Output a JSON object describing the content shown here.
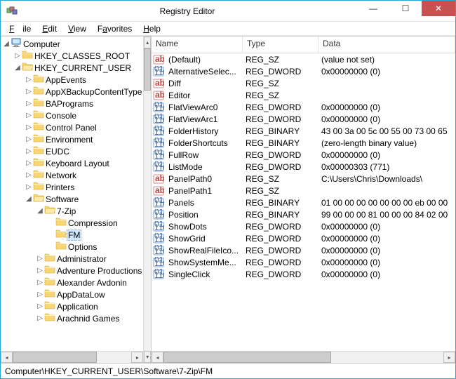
{
  "window": {
    "title": "Registry Editor"
  },
  "menu": {
    "file": "File",
    "edit": "Edit",
    "view": "View",
    "favorites": "Favorites",
    "help": "Help"
  },
  "tree": {
    "root": "Computer",
    "hkcr": "HKEY_CLASSES_ROOT",
    "hkcu": "HKEY_CURRENT_USER",
    "items": [
      "AppEvents",
      "AppXBackupContentType",
      "BAPrograms",
      "Console",
      "Control Panel",
      "Environment",
      "EUDC",
      "Keyboard Layout",
      "Network",
      "Printers",
      "Software"
    ],
    "sevenzip": "7-Zip",
    "sevenzip_children": [
      "Compression",
      "FM",
      "Options"
    ],
    "after_software": [
      "Administrator",
      "Adventure Productions",
      "Alexander Avdonin",
      "AppDataLow",
      "Application",
      "Arachnid Games"
    ]
  },
  "list": {
    "columns": {
      "name": "Name",
      "type": "Type",
      "data": "Data"
    },
    "rows": [
      {
        "icon": "str",
        "name": "(Default)",
        "type": "REG_SZ",
        "data": "(value not set)"
      },
      {
        "icon": "bin",
        "name": "AlternativeSelec...",
        "type": "REG_DWORD",
        "data": "0x00000000 (0)"
      },
      {
        "icon": "str",
        "name": "Diff",
        "type": "REG_SZ",
        "data": ""
      },
      {
        "icon": "str",
        "name": "Editor",
        "type": "REG_SZ",
        "data": ""
      },
      {
        "icon": "bin",
        "name": "FlatViewArc0",
        "type": "REG_DWORD",
        "data": "0x00000000 (0)"
      },
      {
        "icon": "bin",
        "name": "FlatViewArc1",
        "type": "REG_DWORD",
        "data": "0x00000000 (0)"
      },
      {
        "icon": "bin",
        "name": "FolderHistory",
        "type": "REG_BINARY",
        "data": "43 00 3a 00 5c 00 55 00 73 00 65"
      },
      {
        "icon": "bin",
        "name": "FolderShortcuts",
        "type": "REG_BINARY",
        "data": "(zero-length binary value)"
      },
      {
        "icon": "bin",
        "name": "FullRow",
        "type": "REG_DWORD",
        "data": "0x00000000 (0)"
      },
      {
        "icon": "bin",
        "name": "ListMode",
        "type": "REG_DWORD",
        "data": "0x00000303 (771)"
      },
      {
        "icon": "str",
        "name": "PanelPath0",
        "type": "REG_SZ",
        "data": "C:\\Users\\Chris\\Downloads\\"
      },
      {
        "icon": "str",
        "name": "PanelPath1",
        "type": "REG_SZ",
        "data": ""
      },
      {
        "icon": "bin",
        "name": "Panels",
        "type": "REG_BINARY",
        "data": "01 00 00 00 00 00 00 00 eb 00 00"
      },
      {
        "icon": "bin",
        "name": "Position",
        "type": "REG_BINARY",
        "data": "99 00 00 00 81 00 00 00 84 02 00"
      },
      {
        "icon": "bin",
        "name": "ShowDots",
        "type": "REG_DWORD",
        "data": "0x00000000 (0)"
      },
      {
        "icon": "bin",
        "name": "ShowGrid",
        "type": "REG_DWORD",
        "data": "0x00000000 (0)"
      },
      {
        "icon": "bin",
        "name": "ShowRealFileIco...",
        "type": "REG_DWORD",
        "data": "0x00000000 (0)"
      },
      {
        "icon": "bin",
        "name": "ShowSystemMe...",
        "type": "REG_DWORD",
        "data": "0x00000000 (0)"
      },
      {
        "icon": "bin",
        "name": "SingleClick",
        "type": "REG_DWORD",
        "data": "0x00000000 (0)"
      }
    ]
  },
  "status": {
    "path": "Computer\\HKEY_CURRENT_USER\\Software\\7-Zip\\FM"
  }
}
